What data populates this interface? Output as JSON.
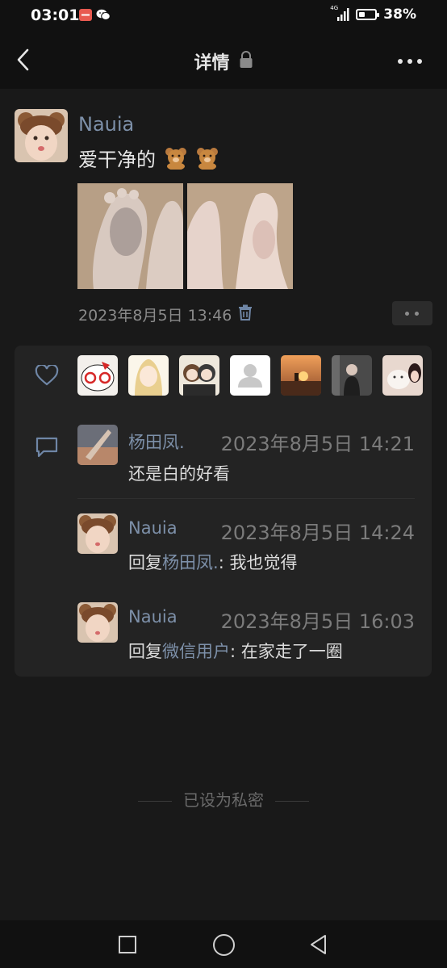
{
  "status_bar": {
    "time": "03:01",
    "network_type": "4G",
    "battery_percent": "38%",
    "battery_level": 0.38
  },
  "header": {
    "title": "详情"
  },
  "post": {
    "author": "Nauia",
    "text": "爱干净的",
    "emoji": "bear-icon",
    "date": "2023年8月5日 13:46"
  },
  "likes": {
    "count": 7
  },
  "comments": [
    {
      "author": "杨田凤.",
      "time": "2023年8月5日 14:21",
      "text": "还是白的好看",
      "reply_to": ""
    },
    {
      "author": "Nauia",
      "time": "2023年8月5日 14:24",
      "reply_prefix": "回复",
      "reply_to": "杨田凤.",
      "separator": ": ",
      "text": "我也觉得"
    },
    {
      "author": "Nauia",
      "time": "2023年8月5日 16:03",
      "reply_prefix": "回复",
      "reply_to": "微信用户",
      "separator": ": ",
      "text": "在家走了一圈"
    }
  ],
  "privacy_note": "已设为私密",
  "colors": {
    "background": "#191919",
    "bar": "#111111",
    "panel": "#232323",
    "name_link": "#7d90a9"
  }
}
